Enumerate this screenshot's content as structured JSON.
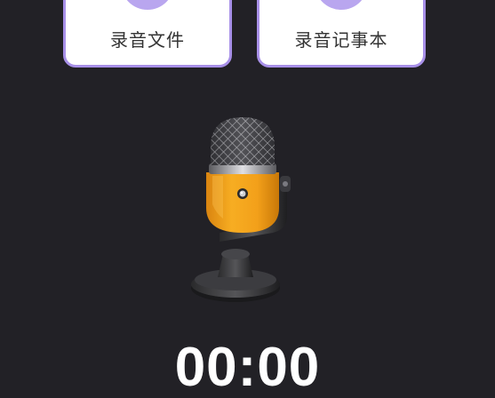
{
  "cards": {
    "files": {
      "label": "录音文件"
    },
    "notes": {
      "label": "录音记事本"
    }
  },
  "recorder": {
    "illustration": "microphone-icon",
    "timer": "00:00"
  },
  "colors": {
    "background": "#222126",
    "card_border": "#a890e8",
    "card_icon": "#b9a6ef",
    "mic_body": "#f2a31d"
  }
}
